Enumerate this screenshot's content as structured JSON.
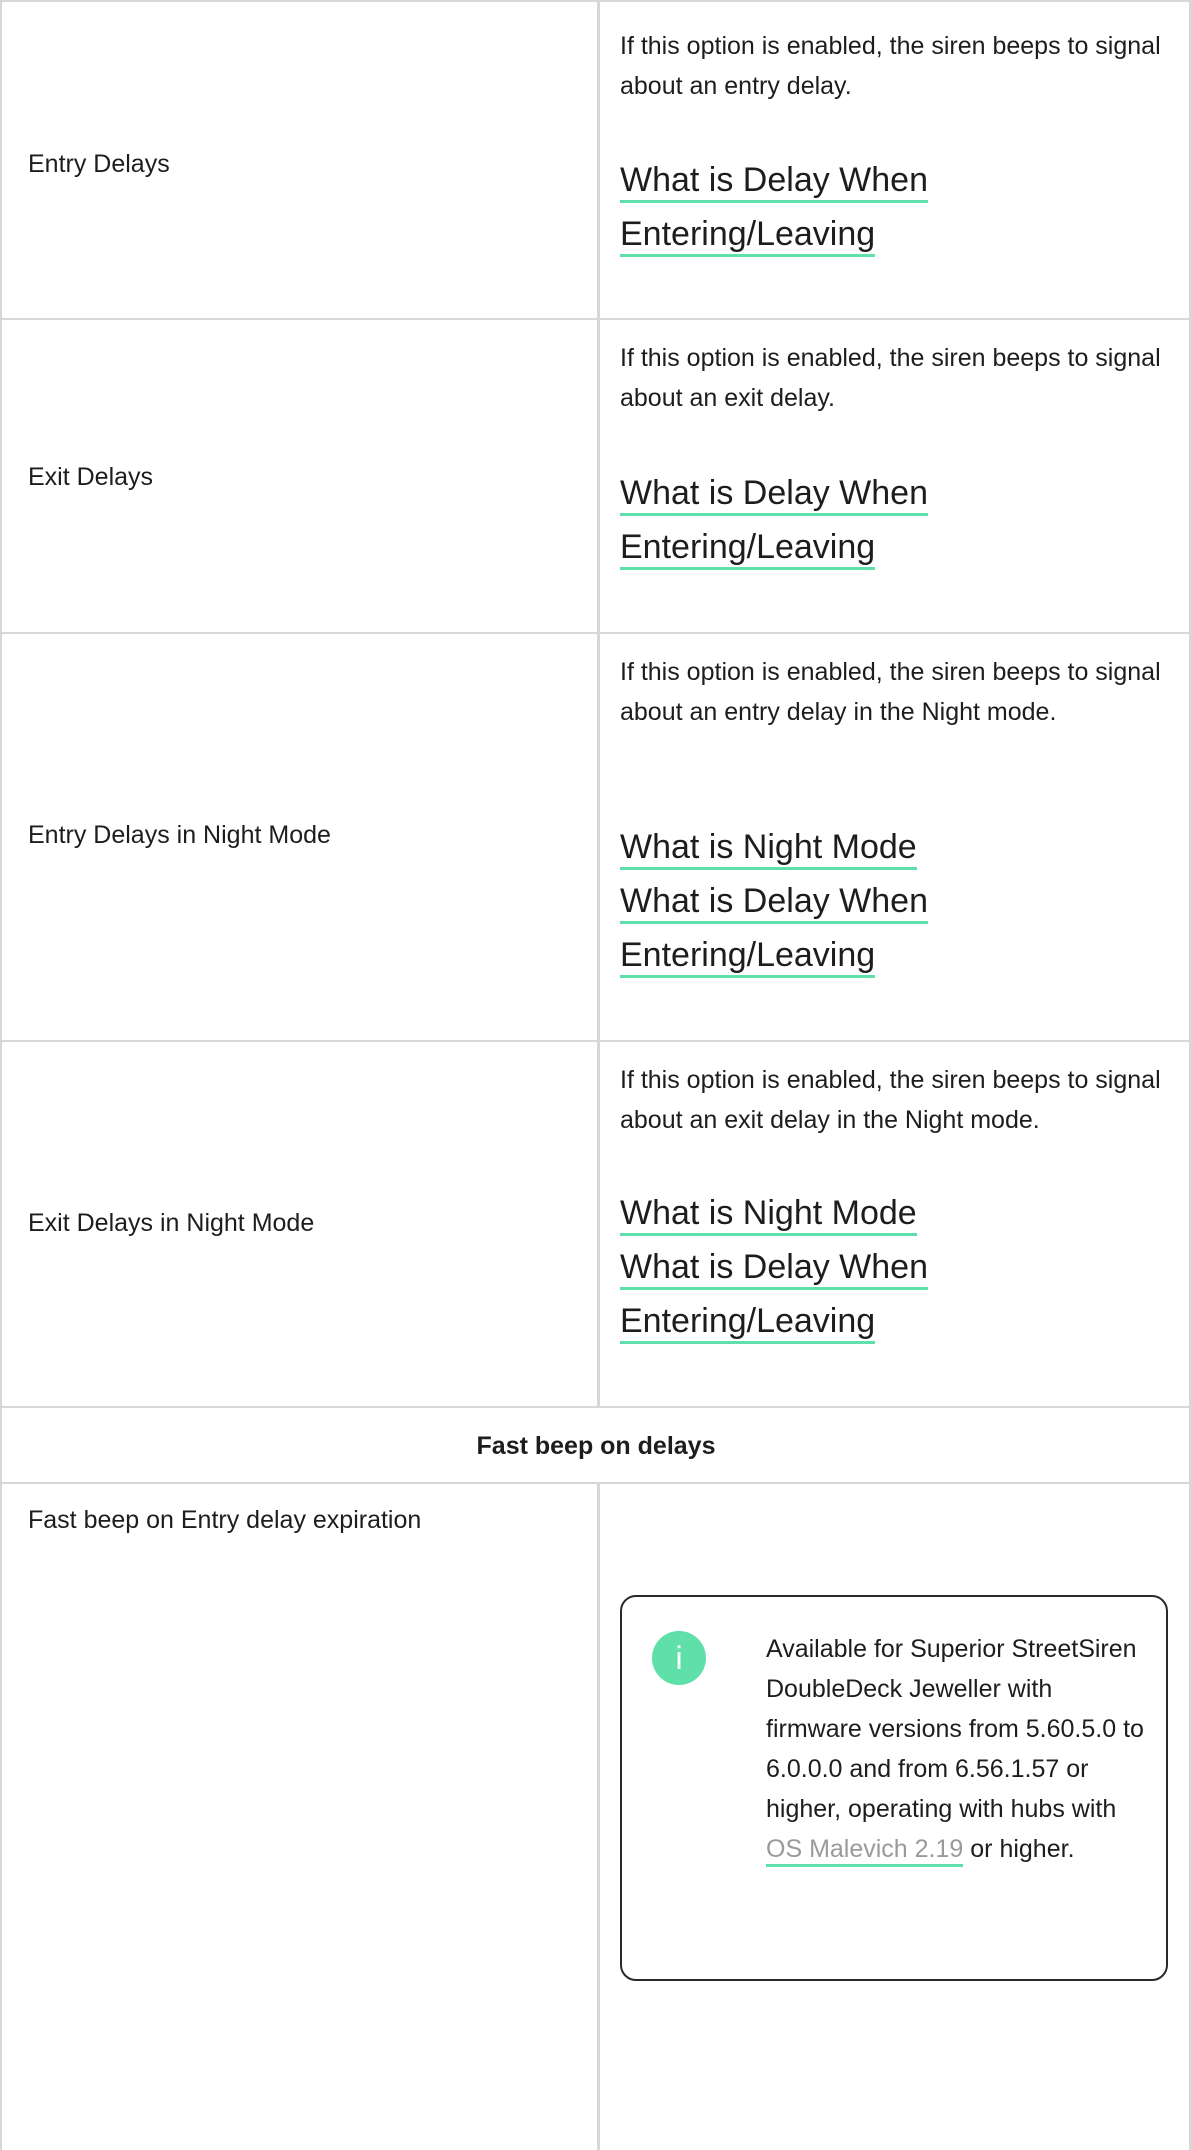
{
  "rows": [
    {
      "label": "Entry Delays",
      "description": "If this option is enabled, the siren beeps to signal about an entry delay.",
      "links": [
        "What is Delay When Entering/Leaving"
      ]
    },
    {
      "label": "Exit Delays",
      "description": "If this option is enabled, the siren beeps to signal about an exit delay.",
      "links": [
        "What is Delay When Entering/Leaving"
      ]
    },
    {
      "label": "Entry Delays in Night Mode",
      "description": "If this option is enabled, the siren beeps to signal about an entry delay in the Night mode.",
      "links": [
        "What is Night Mode",
        "What is Delay When Entering/Leaving"
      ]
    },
    {
      "label": "Exit Delays in Night Mode",
      "description": "If this option is enabled, the siren beeps to signal about an exit delay in the Night mode.",
      "links": [
        "What is Night Mode",
        "What is Delay When Entering/Leaving"
      ]
    }
  ],
  "section": {
    "title": "Fast beep on delays"
  },
  "fast_beep_row": {
    "label": "Fast beep on Entry delay expiration",
    "note": {
      "text_before": "Available for Superior StreetSiren DoubleDeck Jeweller with firmware versions from 5.60.5.0 to 6.0.0.0 and from 6.56.1.57 or higher, operating with hubs with ",
      "link": "OS Malevich 2.19",
      "text_after": " or higher.",
      "icon": "info-icon",
      "icon_glyph": "i"
    }
  },
  "colors": {
    "accent": "#5fe0a8",
    "border": "#d7d7d7",
    "text": "#1d1d1d",
    "link_muted": "#9a9a9a"
  }
}
